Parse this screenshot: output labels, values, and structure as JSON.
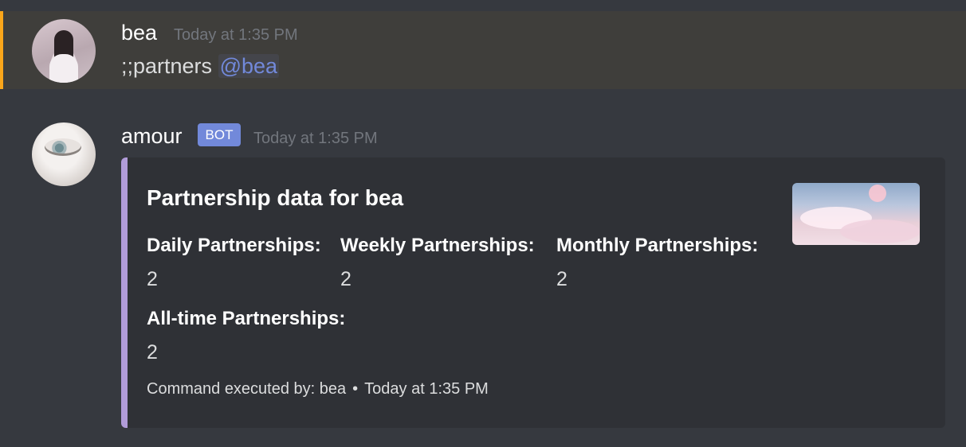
{
  "messages": [
    {
      "username": "bea",
      "timestamp": "Today at 1:35 PM",
      "text": ";;partners ",
      "mention": "@bea"
    },
    {
      "username": "amour",
      "bot_tag": "BOT",
      "timestamp": "Today at 1:35 PM",
      "embed": {
        "accent_color": "#b19cd9",
        "title": "Partnership data for bea",
        "fields": [
          {
            "name": "Daily Partnerships:",
            "value": "2"
          },
          {
            "name": "Weekly Partnerships:",
            "value": "2"
          },
          {
            "name": "Monthly Partnerships:",
            "value": "2"
          },
          {
            "name": "All-time Partnerships:",
            "value": "2"
          }
        ],
        "footer": {
          "text": "Command executed by: bea",
          "separator": "•",
          "timestamp": "Today at 1:35 PM"
        }
      }
    }
  ],
  "colors": {
    "background": "#36393f",
    "highlight_bar": "#faa61a",
    "mention": "#7289da",
    "bot_tag": "#7289da",
    "embed_bg": "#2f3136"
  }
}
